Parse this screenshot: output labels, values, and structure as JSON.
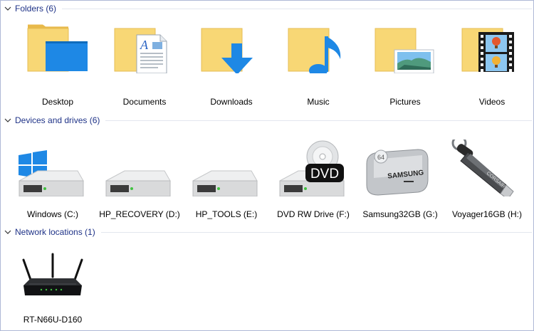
{
  "groups": {
    "folders": {
      "title": "Folders (6)",
      "items": [
        {
          "label": "Desktop",
          "icon": "desktop-folder-icon"
        },
        {
          "label": "Documents",
          "icon": "documents-folder-icon"
        },
        {
          "label": "Downloads",
          "icon": "downloads-folder-icon"
        },
        {
          "label": "Music",
          "icon": "music-folder-icon"
        },
        {
          "label": "Pictures",
          "icon": "pictures-folder-icon"
        },
        {
          "label": "Videos",
          "icon": "videos-folder-icon"
        }
      ]
    },
    "devices": {
      "title": "Devices and drives (6)",
      "items": [
        {
          "label": "Windows (C:)",
          "icon": "windows-drive-icon"
        },
        {
          "label": "HP_RECOVERY (D:)",
          "icon": "hard-drive-icon"
        },
        {
          "label": "HP_TOOLS (E:)",
          "icon": "hard-drive-icon"
        },
        {
          "label": "DVD RW Drive (F:)",
          "icon": "dvd-drive-icon",
          "badge": "DVD"
        },
        {
          "label": "Samsung32GB (G:)",
          "icon": "usb-drive-icon",
          "brand": "SAMSUNG",
          "capacity": "64"
        },
        {
          "label": "Voyager16GB (H:)",
          "icon": "usb-drive-icon",
          "brand": "CORSAIR"
        }
      ]
    },
    "network": {
      "title": "Network locations (1)",
      "items": [
        {
          "label": "RT-N66U-D160",
          "icon": "router-icon"
        }
      ]
    }
  },
  "colors": {
    "header_text": "#1e3287",
    "folder_yellow": "#f8d775",
    "folder_back": "#e8b94a",
    "accent_blue": "#1e88e5",
    "drive_grey": "#d9dadb",
    "led_green": "#41c241"
  }
}
